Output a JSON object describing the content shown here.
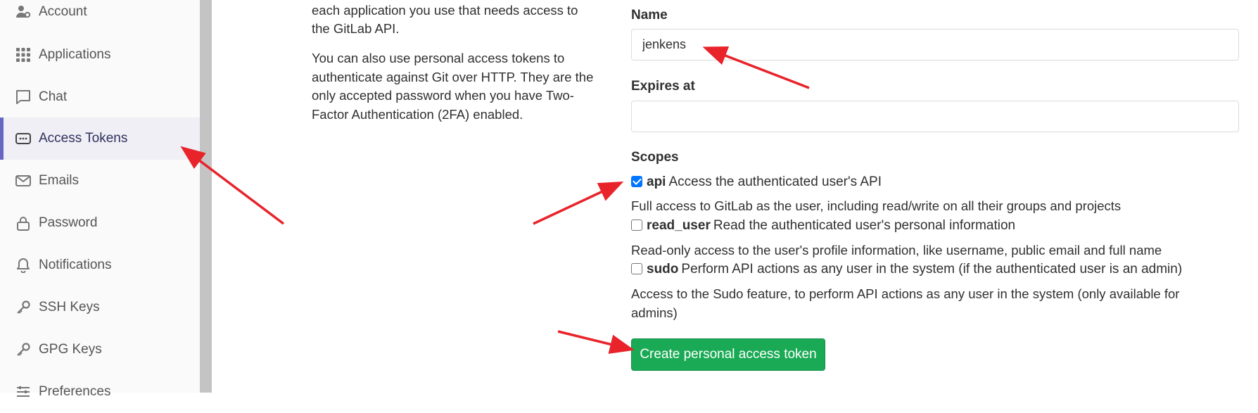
{
  "sidebar": {
    "items": [
      {
        "label": "Account",
        "icon": "account-icon",
        "active": false
      },
      {
        "label": "Applications",
        "icon": "applications-icon",
        "active": false
      },
      {
        "label": "Chat",
        "icon": "chat-icon",
        "active": false
      },
      {
        "label": "Access Tokens",
        "icon": "token-icon",
        "active": true
      },
      {
        "label": "Emails",
        "icon": "mail-icon",
        "active": false
      },
      {
        "label": "Password",
        "icon": "lock-icon",
        "active": false
      },
      {
        "label": "Notifications",
        "icon": "bell-icon",
        "active": false
      },
      {
        "label": "SSH Keys",
        "icon": "key-icon",
        "active": false
      },
      {
        "label": "GPG Keys",
        "icon": "key-icon",
        "active": false
      },
      {
        "label": "Preferences",
        "icon": "preferences-icon",
        "active": false
      }
    ]
  },
  "description": {
    "line1": "each application you use that needs access to",
    "line2": "the GitLab API.",
    "para2": "You can also use personal access tokens to authenticate against Git over HTTP. They are the only accepted password when you have Two-Factor Authentication (2FA) enabled."
  },
  "form": {
    "name_label": "Name",
    "name_value": "jenkens",
    "expires_label": "Expires at",
    "expires_value": "",
    "scopes_label": "Scopes",
    "scopes": [
      {
        "name": "api",
        "desc": "Access the authenticated user's API",
        "checked": true,
        "help": "Full access to GitLab as the user, including read/write on all their groups and projects"
      },
      {
        "name": "read_user",
        "desc": "Read the authenticated user's personal information",
        "checked": false,
        "help": "Read-only access to the user's profile information, like username, public email and full name"
      },
      {
        "name": "sudo",
        "desc": "Perform API actions as any user in the system (if the authenticated user is an admin)",
        "checked": false,
        "help": "Access to the Sudo feature, to perform API actions as any user in the system (only available for admins)"
      }
    ],
    "submit_label": "Create personal access token"
  },
  "colors": {
    "active_accent": "#6666c4",
    "button_green": "#1aaa55",
    "annotation_red": "#e8232a"
  }
}
